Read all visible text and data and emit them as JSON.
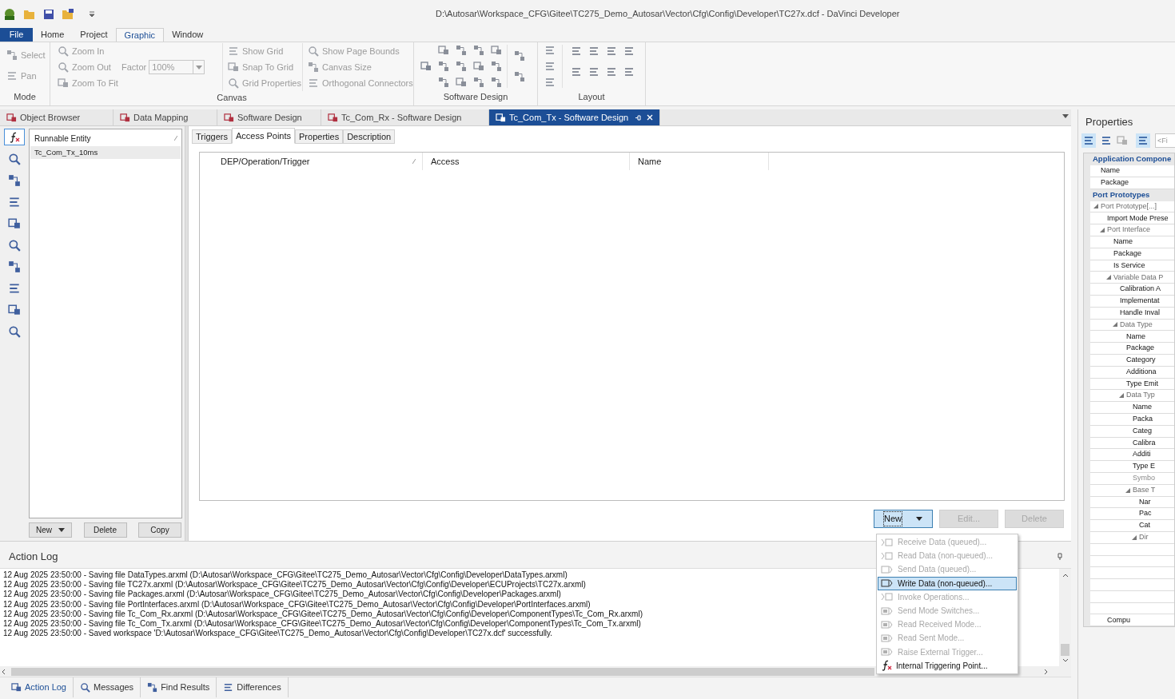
{
  "title_bar": {
    "path": "D:\\Autosar\\Workspace_CFG\\Gitee\\TC275_Demo_Autosar\\Vector\\Cfg\\Config\\Developer\\TC27x.dcf - DaVinci Developer"
  },
  "ribbon_tabs": [
    {
      "label": "File",
      "kind": "file",
      "selected": false
    },
    {
      "label": "Home",
      "kind": "tab",
      "selected": false
    },
    {
      "label": "Project",
      "kind": "tab",
      "selected": false
    },
    {
      "label": "Graphic",
      "kind": "tab",
      "selected": true
    },
    {
      "label": "Window",
      "kind": "tab",
      "selected": false
    }
  ],
  "ribbon": {
    "mode": {
      "label": "Mode",
      "items": [
        "Select",
        "Pan"
      ]
    },
    "canvas": {
      "label": "Canvas",
      "zoom_items": [
        "Zoom In",
        "Zoom Out",
        "Zoom To Fit"
      ],
      "factor_label": "Factor",
      "factor_value": "100%",
      "grid_items": [
        "Show Grid",
        "Snap To Grid",
        "Grid Properties"
      ],
      "page_items": [
        "Show Page Bounds",
        "Canvas Size",
        "Orthogonal Connectors"
      ]
    },
    "software_design": {
      "label": "Software Design"
    },
    "layout": {
      "label": "Layout"
    }
  },
  "document_tabs": [
    {
      "label": "Object Browser",
      "selected": false
    },
    {
      "label": "Data Mapping",
      "selected": false
    },
    {
      "label": "Software Design",
      "selected": false
    },
    {
      "label": "Tc_Com_Rx - Software Design",
      "selected": false
    },
    {
      "label": "Tc_Com_Tx - Software Design",
      "selected": true
    }
  ],
  "tool_strip": [
    {
      "selected": true
    },
    {
      "selected": false
    },
    {
      "selected": false
    },
    {
      "selected": false
    },
    {
      "selected": false
    },
    {
      "selected": false
    },
    {
      "selected": false
    },
    {
      "selected": false
    },
    {
      "selected": false
    },
    {
      "selected": false
    }
  ],
  "runnables": {
    "column": "Runnable Entity",
    "rows": [
      {
        "label": "Tc_Com_Tx_10ms",
        "selected": true
      }
    ],
    "buttons": [
      {
        "label": "New",
        "kind": "split"
      },
      {
        "label": "Delete",
        "kind": "plain"
      },
      {
        "label": "Copy",
        "kind": "plain"
      }
    ]
  },
  "inner_tabs": [
    {
      "label": "Triggers",
      "selected": false
    },
    {
      "label": "Access Points",
      "selected": true
    },
    {
      "label": "Properties",
      "selected": false
    },
    {
      "label": "Description",
      "selected": false
    }
  ],
  "access_table": {
    "columns": [
      "DEP/Operation/Trigger",
      "Access",
      "Name"
    ]
  },
  "access_buttons": [
    {
      "label": "New",
      "kind": "split",
      "disabled": false
    },
    {
      "label": "Edit...",
      "kind": "plain",
      "disabled": true
    },
    {
      "label": "Delete",
      "kind": "plain",
      "disabled": true
    }
  ],
  "new_menu": [
    {
      "label": "Receive Data (queued)...",
      "kind": "receive",
      "disabled": true,
      "selected": false
    },
    {
      "label": "Read Data (non-queued)...",
      "kind": "receive",
      "disabled": true,
      "selected": false
    },
    {
      "label": "Send Data (queued)...",
      "kind": "send",
      "disabled": true,
      "selected": false
    },
    {
      "label": "Write Data (non-queued)...",
      "kind": "send",
      "disabled": false,
      "selected": true
    },
    {
      "label": "Invoke Operations...",
      "kind": "receive",
      "disabled": true,
      "selected": false
    },
    {
      "label": "Send Mode Switches...",
      "kind": "mode",
      "disabled": true,
      "selected": false
    },
    {
      "label": "Read Received Mode...",
      "kind": "mode",
      "disabled": true,
      "selected": false
    },
    {
      "label": "Read Sent Mode...",
      "kind": "mode",
      "disabled": true,
      "selected": false
    },
    {
      "label": "Raise External Trigger...",
      "kind": "mode",
      "disabled": true,
      "selected": false
    },
    {
      "label": "Internal Triggering Point...",
      "kind": "function",
      "disabled": false,
      "selected": false
    }
  ],
  "action_log": {
    "title": "Action Log",
    "lines": [
      "12 Aug 2025 23:50:00 - Saving file DataTypes.arxml (D:\\Autosar\\Workspace_CFG\\Gitee\\TC275_Demo_Autosar\\Vector\\Cfg\\Config\\Developer\\DataTypes.arxml)",
      "12 Aug 2025 23:50:00 - Saving file TC27x.arxml (D:\\Autosar\\Workspace_CFG\\Gitee\\TC275_Demo_Autosar\\Vector\\Cfg\\Config\\Developer\\ECUProjects\\TC27x.arxml)",
      "12 Aug 2025 23:50:00 - Saving file Packages.arxml (D:\\Autosar\\Workspace_CFG\\Gitee\\TC275_Demo_Autosar\\Vector\\Cfg\\Config\\Developer\\Packages.arxml)",
      "12 Aug 2025 23:50:00 - Saving file PortInterfaces.arxml (D:\\Autosar\\Workspace_CFG\\Gitee\\TC275_Demo_Autosar\\Vector\\Cfg\\Config\\Developer\\PortInterfaces.arxml)",
      "12 Aug 2025 23:50:00 - Saving file Tc_Com_Rx.arxml (D:\\Autosar\\Workspace_CFG\\Gitee\\TC275_Demo_Autosar\\Vector\\Cfg\\Config\\Developer\\ComponentTypes\\Tc_Com_Rx.arxml)",
      "12 Aug 2025 23:50:00 - Saving file Tc_Com_Tx.arxml (D:\\Autosar\\Workspace_CFG\\Gitee\\TC275_Demo_Autosar\\Vector\\Cfg\\Config\\Developer\\ComponentTypes\\Tc_Com_Tx.arxml)",
      "12 Aug 2025 23:50:00 - Saved workspace 'D:\\Autosar\\Workspace_CFG\\Gitee\\TC275_Demo_Autosar\\Vector\\Cfg\\Config\\Developer\\TC27x.dcf' successfully."
    ]
  },
  "bottom_tabs": [
    {
      "label": "Action Log",
      "selected": true
    },
    {
      "label": "Messages",
      "selected": false
    },
    {
      "label": "Find Results",
      "selected": false
    },
    {
      "label": "Differences",
      "selected": false
    }
  ],
  "properties": {
    "title": "Properties",
    "filter_placeholder": "<Fi",
    "sections": [
      {
        "title": "Application Compone",
        "items": [
          {
            "label": "Name",
            "kind": "field"
          },
          {
            "label": "Package",
            "kind": "field"
          }
        ]
      },
      {
        "title": "Port Prototypes",
        "items": [
          {
            "label": "Port Prototype[...]",
            "kind": "group",
            "children": [
              {
                "label": "Import Mode Prese",
                "kind": "field"
              },
              {
                "label": "Port Interface",
                "kind": "group",
                "children": [
                  {
                    "label": "Name",
                    "kind": "field"
                  },
                  {
                    "label": "Package",
                    "kind": "field"
                  },
                  {
                    "label": "Is Service",
                    "kind": "field"
                  },
                  {
                    "label": "Variable Data P",
                    "kind": "group",
                    "children": [
                      {
                        "label": "Calibration A",
                        "kind": "field"
                      },
                      {
                        "label": "Implementat",
                        "kind": "field"
                      },
                      {
                        "label": "Handle Inval",
                        "kind": "field"
                      },
                      {
                        "label": "Data Type",
                        "kind": "group",
                        "children": [
                          {
                            "label": "Name",
                            "kind": "field"
                          },
                          {
                            "label": "Package",
                            "kind": "field"
                          },
                          {
                            "label": "Category",
                            "kind": "field"
                          },
                          {
                            "label": "Additiona",
                            "kind": "field"
                          },
                          {
                            "label": "Type Emit",
                            "kind": "field"
                          },
                          {
                            "label": "Data Typ",
                            "kind": "group",
                            "children": [
                              {
                                "label": "Name",
                                "kind": "field"
                              },
                              {
                                "label": "Packa",
                                "kind": "field"
                              },
                              {
                                "label": "Categ",
                                "kind": "field"
                              },
                              {
                                "label": "Calibra",
                                "kind": "field"
                              },
                              {
                                "label": "Additi",
                                "kind": "field"
                              },
                              {
                                "label": "Type E",
                                "kind": "field"
                              },
                              {
                                "label": "Symbo",
                                "kind": "muted"
                              },
                              {
                                "label": "Base T",
                                "kind": "group",
                                "children": [
                                  {
                                    "label": "Nar",
                                    "kind": "field"
                                  },
                                  {
                                    "label": "Pac",
                                    "kind": "field"
                                  },
                                  {
                                    "label": "Cat",
                                    "kind": "field"
                                  },
                                  {
                                    "label": "Dir",
                                    "kind": "group",
                                    "children": [
                                      {
                                        "kind": "blank"
                                      },
                                      {
                                        "kind": "blank"
                                      },
                                      {
                                        "kind": "blank"
                                      },
                                      {
                                        "kind": "blank"
                                      },
                                      {
                                        "kind": "blank"
                                      },
                                      {
                                        "kind": "blank"
                                      }
                                    ]
                                  }
                                ]
                              }
                            ]
                          }
                        ]
                      }
                    ]
                  }
                ]
              },
              {
                "label": "Compu",
                "kind": "field"
              }
            ]
          }
        ]
      }
    ]
  }
}
